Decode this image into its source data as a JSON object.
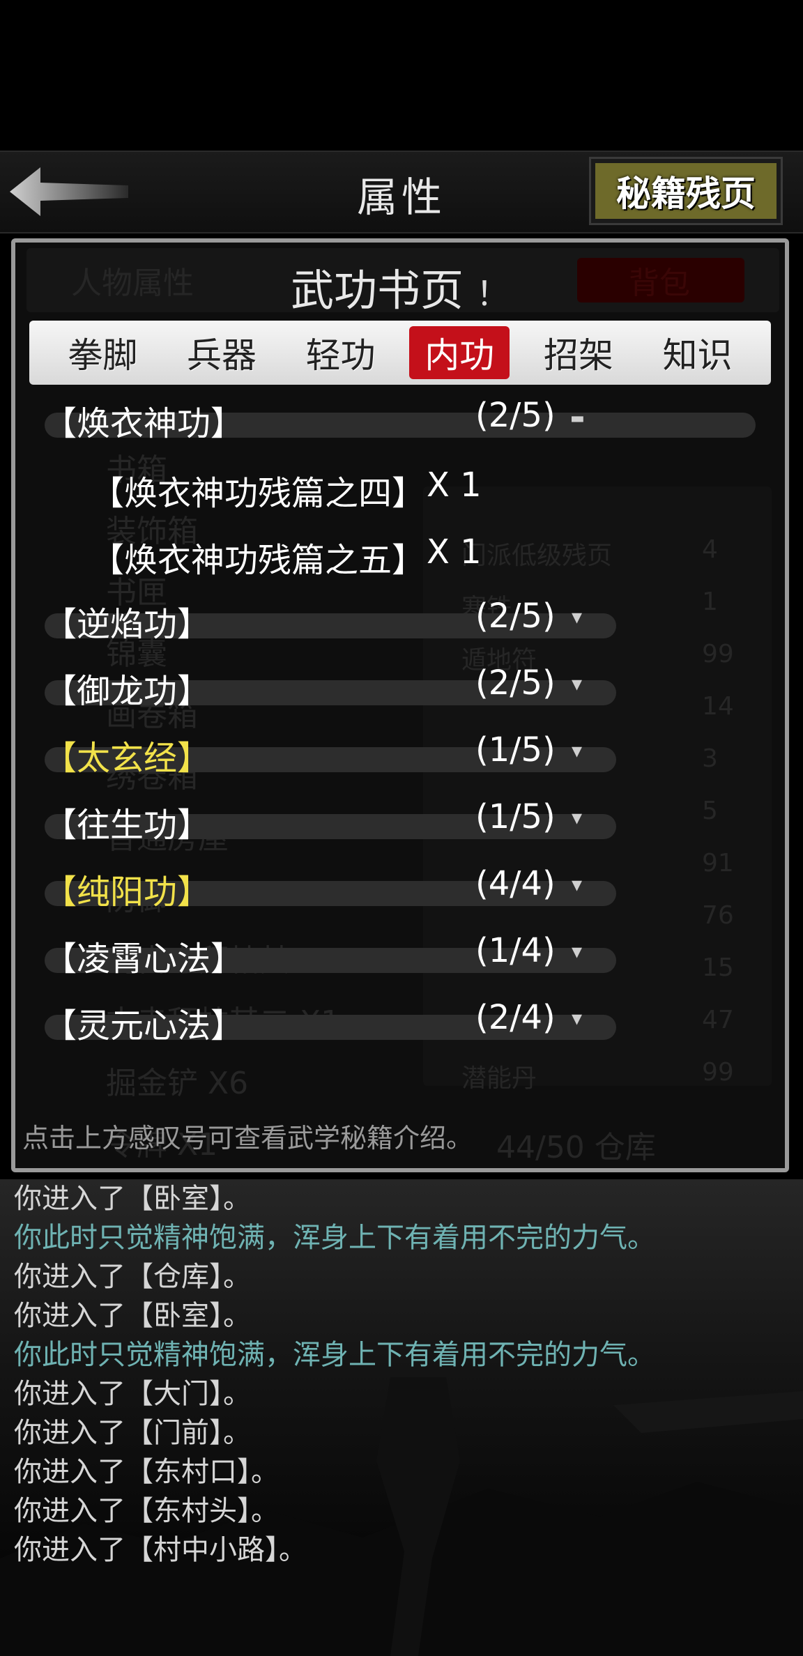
{
  "header": {
    "title": "属性",
    "fragments_button": "秘籍残页"
  },
  "panel": {
    "title": "武功书页",
    "info_mark": "！",
    "tabs": [
      {
        "label": "拳脚",
        "active": false
      },
      {
        "label": "兵器",
        "active": false
      },
      {
        "label": "轻功",
        "active": false
      },
      {
        "label": "内功",
        "active": true
      },
      {
        "label": "招架",
        "active": false
      },
      {
        "label": "知识",
        "active": false
      }
    ],
    "rows": [
      {
        "name": "【焕衣神功】",
        "count": "(2/5)",
        "expanded": true,
        "gold": false
      },
      {
        "name": "【逆焰功】",
        "count": "(2/5)",
        "expanded": false,
        "gold": false
      },
      {
        "name": "【御龙功】",
        "count": "(2/5)",
        "expanded": false,
        "gold": false
      },
      {
        "name": "【太玄经】",
        "count": "(1/5)",
        "expanded": false,
        "gold": true
      },
      {
        "name": "【往生功】",
        "count": "(1/5)",
        "expanded": false,
        "gold": false
      },
      {
        "name": "【纯阳功】",
        "count": "(4/4)",
        "expanded": false,
        "gold": true
      },
      {
        "name": "【凌霄心法】",
        "count": "(1/4)",
        "expanded": false,
        "gold": false
      },
      {
        "name": "【灵元心法】",
        "count": "(2/4)",
        "expanded": false,
        "gold": false
      }
    ],
    "sub_items": [
      {
        "name": "【焕衣神功残篇之四】",
        "qty": "X 1"
      },
      {
        "name": "【焕衣神功残篇之五】",
        "qty": "X 1"
      }
    ],
    "hint": "点击上方感叹号可查看武学秘籍介绍。",
    "background_ghost": {
      "left_tab": "人物属性",
      "right_tab": "背包",
      "lines_left": [
        "书箱",
        "装饰箱",
        "书匣",
        "锦囊",
        "画卷箱",
        "绣卷箱",
        "普通房屋",
        "防御",
        "【古寺拜帖其一 X1",
        "古寺拜帖其二 X1",
        "掘金铲 X6",
        "令牌 X1"
      ],
      "lines_right_names": [
        "门派低级残页",
        "寒铁",
        "遁地符",
        "",
        "",
        "",
        "",
        "",
        "",
        "",
        "潜能丹"
      ],
      "lines_right_vals": [
        "4",
        "1",
        "99",
        "14",
        "3",
        "5",
        "91",
        "76",
        "15",
        "47",
        "99"
      ],
      "footer": "44/50 仓库"
    },
    "toggle_open_icon": "minus-icon",
    "toggle_closed_icon": "caret-down-icon"
  },
  "log": {
    "lines": [
      {
        "text": "你进入了【卧室】。",
        "teal": false
      },
      {
        "text": "你此时只觉精神饱满，浑身上下有着用不完的力气。",
        "teal": true
      },
      {
        "text": "你进入了【仓库】。",
        "teal": false
      },
      {
        "text": "你进入了【卧室】。",
        "teal": false
      },
      {
        "text": "你此时只觉精神饱满，浑身上下有着用不完的力气。",
        "teal": true
      },
      {
        "text": "你进入了【大门】。",
        "teal": false
      },
      {
        "text": "你进入了【门前】。",
        "teal": false
      },
      {
        "text": "你进入了【东村口】。",
        "teal": false
      },
      {
        "text": "你进入了【东村头】。",
        "teal": false
      },
      {
        "text": "你进入了【村中小路】。",
        "teal": false
      }
    ]
  }
}
